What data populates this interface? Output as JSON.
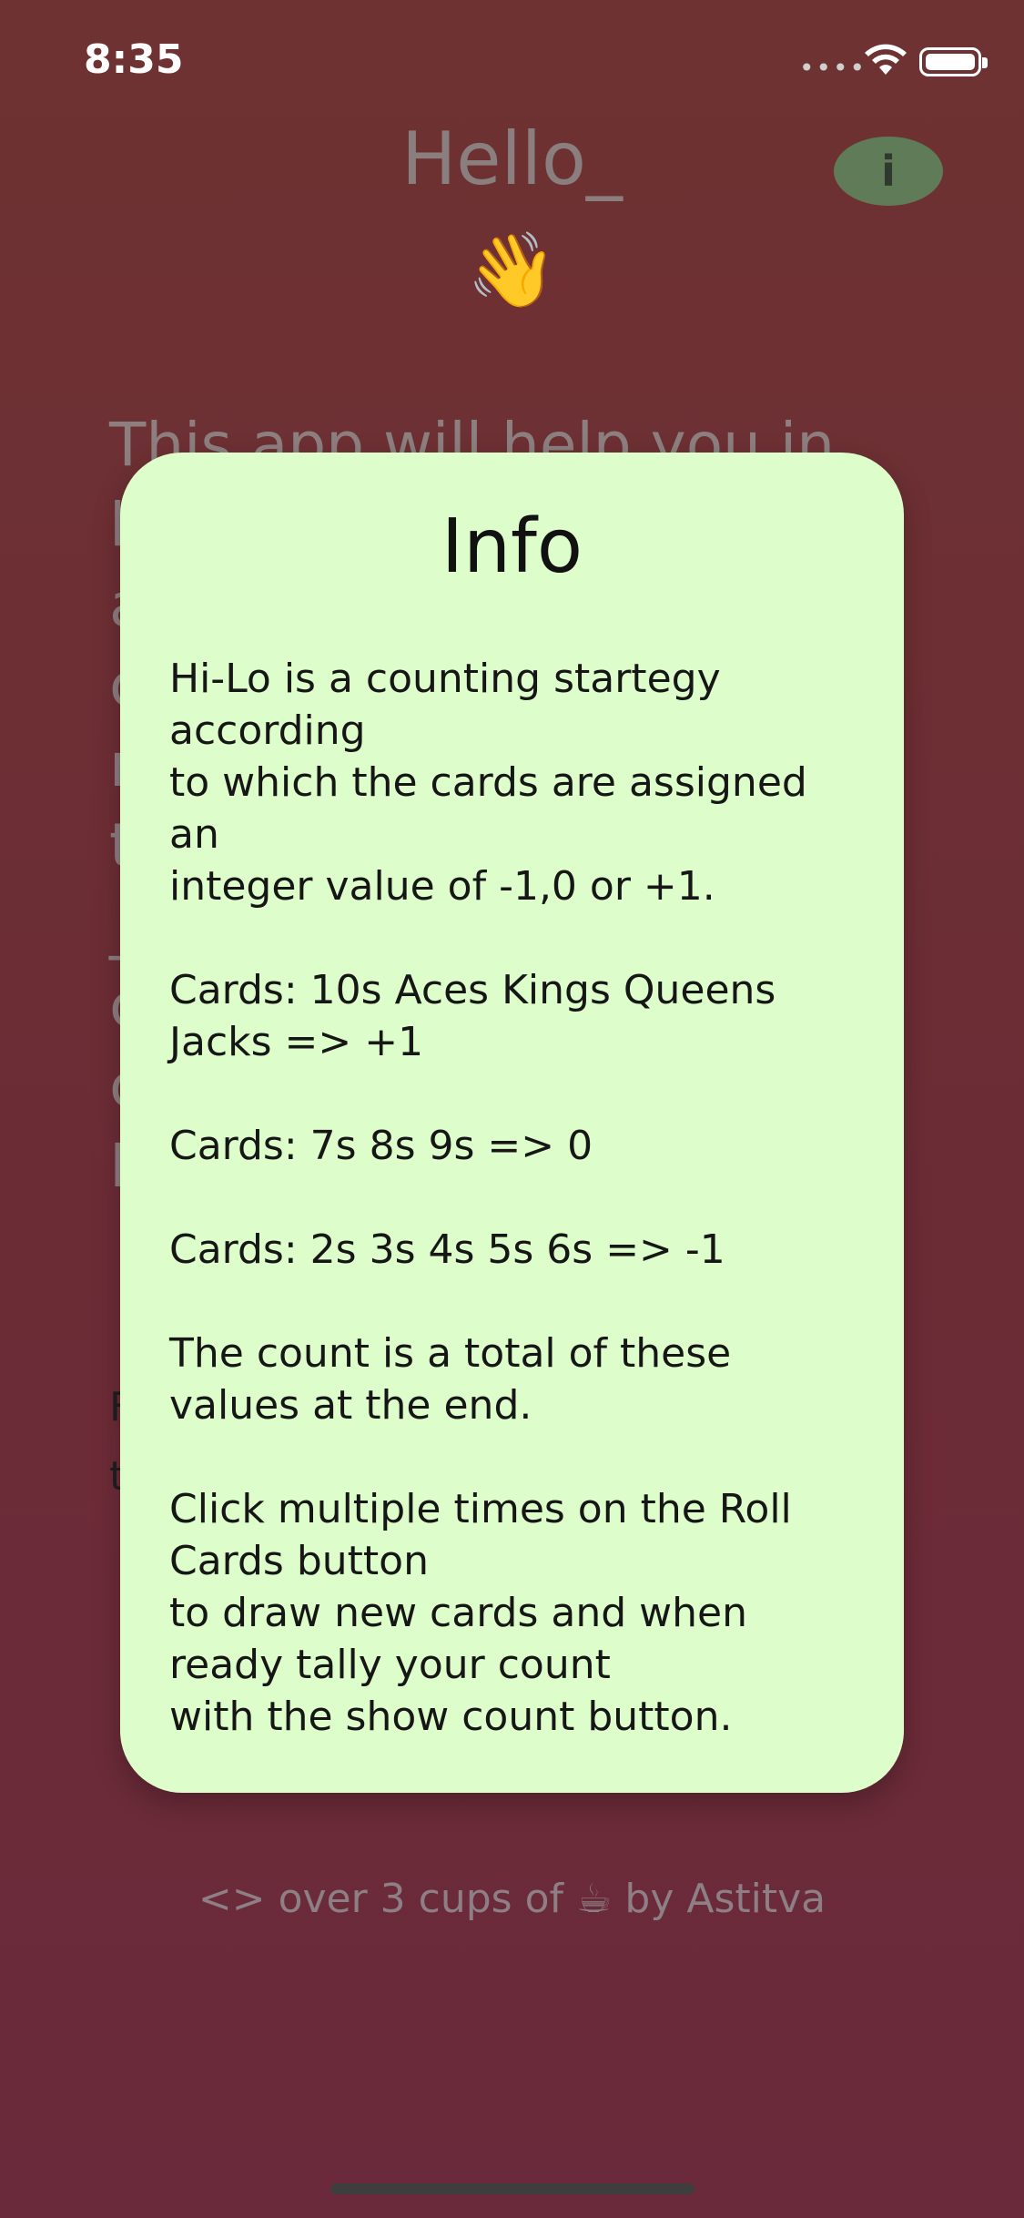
{
  "status": {
    "time": "8:35",
    "signal": "••••"
  },
  "header": {
    "title": "Hello_",
    "emoji": "👋",
    "info_icon": "info-icon",
    "info_glyph": "i"
  },
  "background": {
    "intro_text": "This app will help you in\nl\na\nc\nn\nt\n_\nc\nc\nI",
    "line_1": "F",
    "line_2": "t"
  },
  "modal": {
    "title": "Info",
    "body": "Hi-Lo is a counting startegy\naccording\nto which the cards are assigned\nan\ninteger value of -1,0 or +1.\n\nCards: 10s Aces Kings Queens\nJacks => +1\n\nCards: 7s 8s 9s => 0\n\nCards: 2s 3s 4s 5s 6s => -1\n\nThe count is a total of these\nvalues at the end.\n\nClick multiple times on the Roll\nCards button\nto draw new cards and when\nready tally your count\nwith the show count button."
  },
  "footer": {
    "text": "<> over 3 cups of ☕ by Astitva"
  },
  "colors": {
    "modal_bg": "#ddfdcb",
    "app_bg": "#6e3232",
    "info_button": "#5f7b58"
  }
}
